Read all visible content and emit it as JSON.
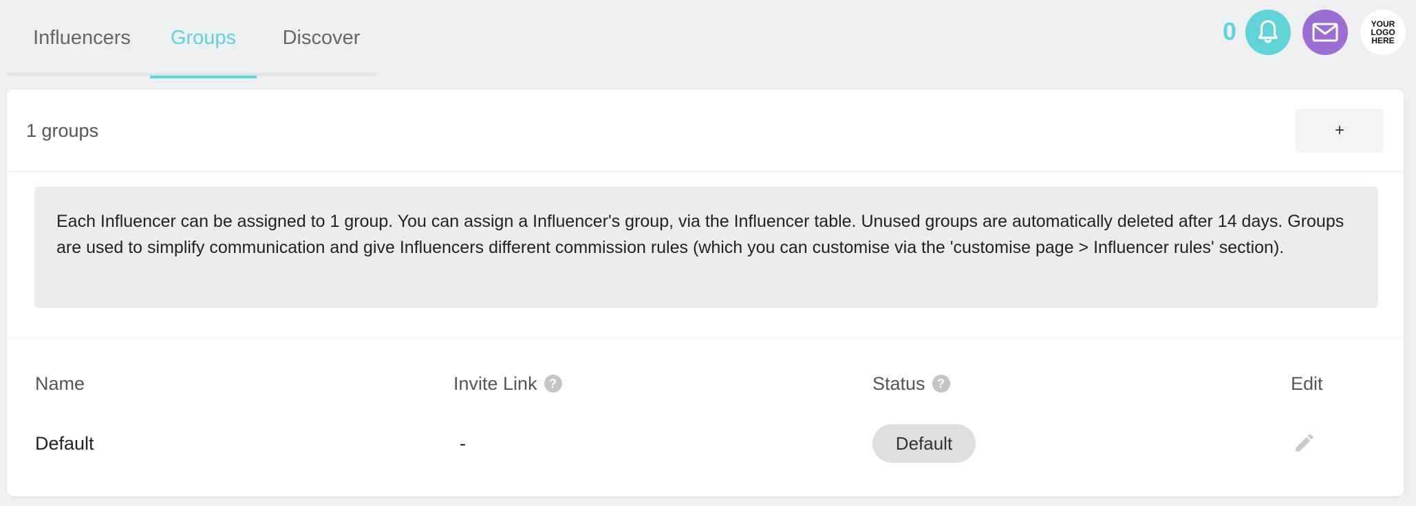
{
  "tabs": [
    {
      "label": "Influencers",
      "active": false
    },
    {
      "label": "Groups",
      "active": true
    },
    {
      "label": "Discover",
      "active": false
    }
  ],
  "header": {
    "notification_count": "0",
    "icons": {
      "bell": "bell-icon",
      "mail": "mail-icon"
    },
    "logo_lines": [
      "YOUR",
      "LOGO",
      "HERE"
    ]
  },
  "colors": {
    "accent": "#5fd3d8",
    "mail": "#9b6fd1",
    "background": "#eeeff0"
  },
  "groups_panel": {
    "count_label": "1 groups",
    "add_label": "+",
    "info_text": "Each Influencer can be assigned to 1 group. You can assign a Influencer's group, via the Influencer table. Unused groups are automatically deleted after 14 days. Groups are used to simplify communication and give Influencers different commission rules (which you can customise via the 'customise page > Influencer rules' section)."
  },
  "table": {
    "columns": [
      {
        "label": "Name",
        "help": false
      },
      {
        "label": "Invite Link",
        "help": true
      },
      {
        "label": "Status",
        "help": true
      },
      {
        "label": "Edit",
        "help": false
      }
    ],
    "help_glyph": "?",
    "rows": [
      {
        "name": "Default",
        "invite_link": "-",
        "status": "Default",
        "edit_icon": "pencil-icon"
      }
    ]
  }
}
